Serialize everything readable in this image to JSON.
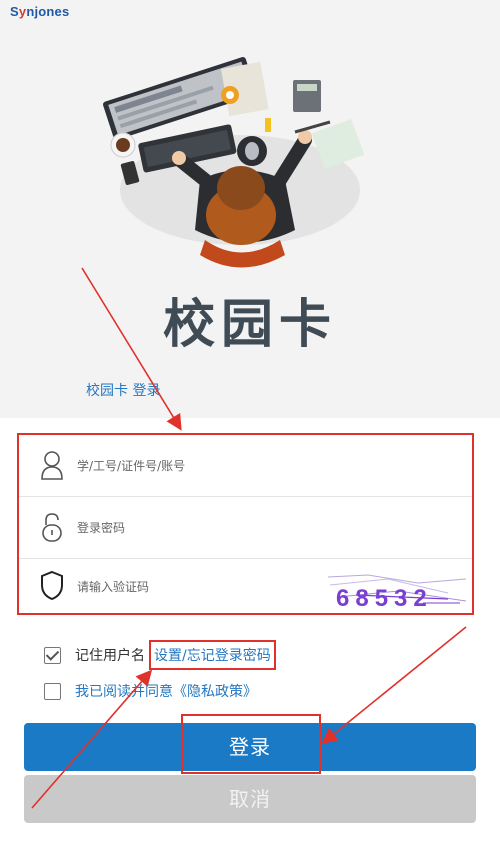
{
  "logo": {
    "part1": "S",
    "part2": "y",
    "part3": "njones"
  },
  "title": "校园卡",
  "tab": {
    "label": "校园卡 登录"
  },
  "form": {
    "account_placeholder": "学/工号/证件号/账号",
    "password_placeholder": "登录密码",
    "captcha_placeholder": "请输入验证码",
    "captcha_text": "68532"
  },
  "options": {
    "remember_label": "记住用户名",
    "forgot_link": "设置/忘记登录密码",
    "remember_checked": true,
    "privacy_text": "我已阅读并同意《隐私政策》",
    "privacy_checked": false
  },
  "buttons": {
    "login": "登录",
    "cancel": "取消"
  },
  "colors": {
    "primary": "#1a7ac5",
    "link": "#2477c0",
    "highlight": "#e0312b",
    "cancel": "#c9c9c9"
  }
}
